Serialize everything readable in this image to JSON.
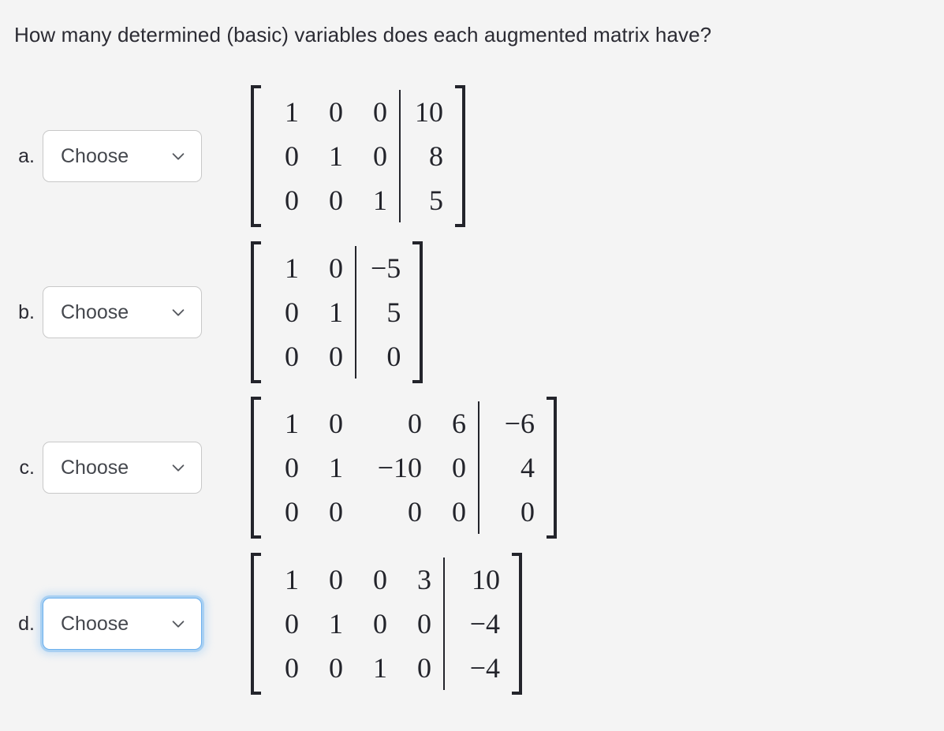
{
  "question": {
    "text": "How many determined (basic) variables does each augmented matrix have?"
  },
  "dropdown": {
    "placeholder_label": "Choose",
    "chevron_icon": "chevron-down-icon"
  },
  "colors": {
    "background": "#f4f4f4",
    "text": "#2b2b33",
    "dropdown_border": "#c8c8c8",
    "dropdown_focus_border": "#6cb0ee",
    "matrix_ink": "#23242b"
  },
  "items": [
    {
      "letter": "a.",
      "select_value": "Choose",
      "focused": false,
      "matrix": {
        "rows": 3,
        "coefficient_columns": 3,
        "augmented_columns": 1,
        "coefficients": [
          [
            "1",
            "0",
            "0"
          ],
          [
            "0",
            "1",
            "0"
          ],
          [
            "0",
            "0",
            "1"
          ]
        ],
        "augmented": [
          [
            "10"
          ],
          [
            "8"
          ],
          [
            "5"
          ]
        ]
      }
    },
    {
      "letter": "b.",
      "select_value": "Choose",
      "focused": false,
      "matrix": {
        "rows": 3,
        "coefficient_columns": 2,
        "augmented_columns": 1,
        "coefficients": [
          [
            "1",
            "0"
          ],
          [
            "0",
            "1"
          ],
          [
            "0",
            "0"
          ]
        ],
        "augmented": [
          [
            "−5"
          ],
          [
            "5"
          ],
          [
            "0"
          ]
        ]
      }
    },
    {
      "letter": "c.",
      "select_value": "Choose",
      "focused": false,
      "matrix": {
        "rows": 3,
        "coefficient_columns": 4,
        "augmented_columns": 1,
        "coefficients": [
          [
            "1",
            "0",
            "0",
            "6"
          ],
          [
            "0",
            "1",
            "−10",
            "0"
          ],
          [
            "0",
            "0",
            "0",
            "0"
          ]
        ],
        "augmented": [
          [
            "−6"
          ],
          [
            "4"
          ],
          [
            "0"
          ]
        ]
      }
    },
    {
      "letter": "d.",
      "select_value": "Choose",
      "focused": true,
      "matrix": {
        "rows": 3,
        "coefficient_columns": 4,
        "augmented_columns": 1,
        "coefficients": [
          [
            "1",
            "0",
            "0",
            "3"
          ],
          [
            "0",
            "1",
            "0",
            "0"
          ],
          [
            "0",
            "0",
            "1",
            "0"
          ]
        ],
        "augmented": [
          [
            "10"
          ],
          [
            "−4"
          ],
          [
            "−4"
          ]
        ]
      }
    }
  ]
}
